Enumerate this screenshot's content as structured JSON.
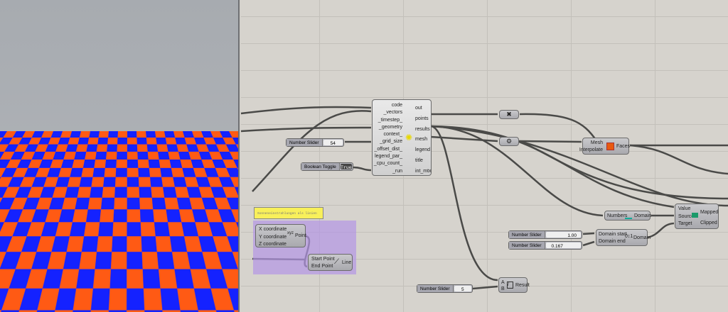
{
  "main_component": {
    "inputs": [
      "code",
      "_vectors",
      "_timestep_",
      "_geometry",
      "context_",
      "_grid_size",
      "_offset_dist_",
      "legend_par_",
      "_cpu_count_",
      "_run"
    ],
    "outputs": [
      "out",
      "points",
      "results",
      "mesh",
      "legend",
      "title",
      "int_mtx"
    ]
  },
  "grid_slider": {
    "label": "Number Slider",
    "value": "54"
  },
  "toggle": {
    "label": "Boolean Toggle",
    "value": "True"
  },
  "panel": {
    "text": "Sonneneinstrahlungen als linien"
  },
  "point_node": {
    "inputs": [
      "X coordinate",
      "Y coordinate",
      "Z coordinate"
    ],
    "output": "Point"
  },
  "line_node": {
    "inputs": [
      "Start Point",
      "End Point"
    ],
    "output": "Line"
  },
  "mesh_colors": {
    "inputs": [
      "Mesh",
      "Interpolate"
    ],
    "output": "Faces"
  },
  "bounds": {
    "input": "Numbers",
    "output": "Domain"
  },
  "remap": {
    "inputs": [
      "Value",
      "Source",
      "Target"
    ],
    "outputs": [
      "Mapped",
      "Clipped"
    ]
  },
  "slider_start": {
    "label": "Number Slider",
    "value": "1.00"
  },
  "slider_end": {
    "label": "Number Slider",
    "value": "0.167"
  },
  "construct_domain": {
    "inputs": [
      "Domain start",
      "Domain end"
    ],
    "output": "Domain"
  },
  "division": {
    "inputs": [
      "A",
      "B"
    ],
    "output": "Result"
  },
  "slider_b": {
    "label": "Number Slider",
    "value": "5"
  },
  "colors": {
    "blue": "#1422ff",
    "orange": "#ff5a14"
  }
}
